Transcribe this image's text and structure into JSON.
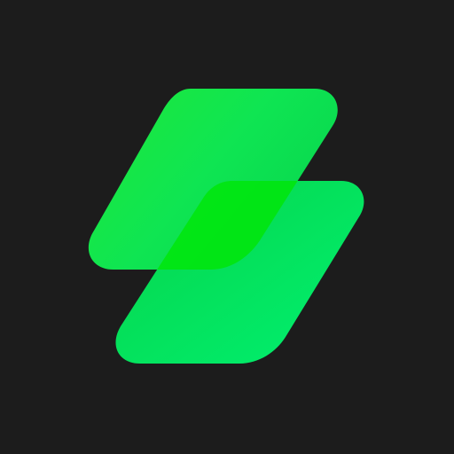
{
  "background_color": "#1c1c1c",
  "logo": {
    "icon": "stacked-layers-logo-icon",
    "colors": {
      "top_light": "#1ee83a",
      "top_mid": "#0fe552",
      "top_dark": "#08d74f",
      "bottom_light": "#08d44a",
      "bottom_dark": "#00f070",
      "overlap": "#00e60a"
    }
  }
}
